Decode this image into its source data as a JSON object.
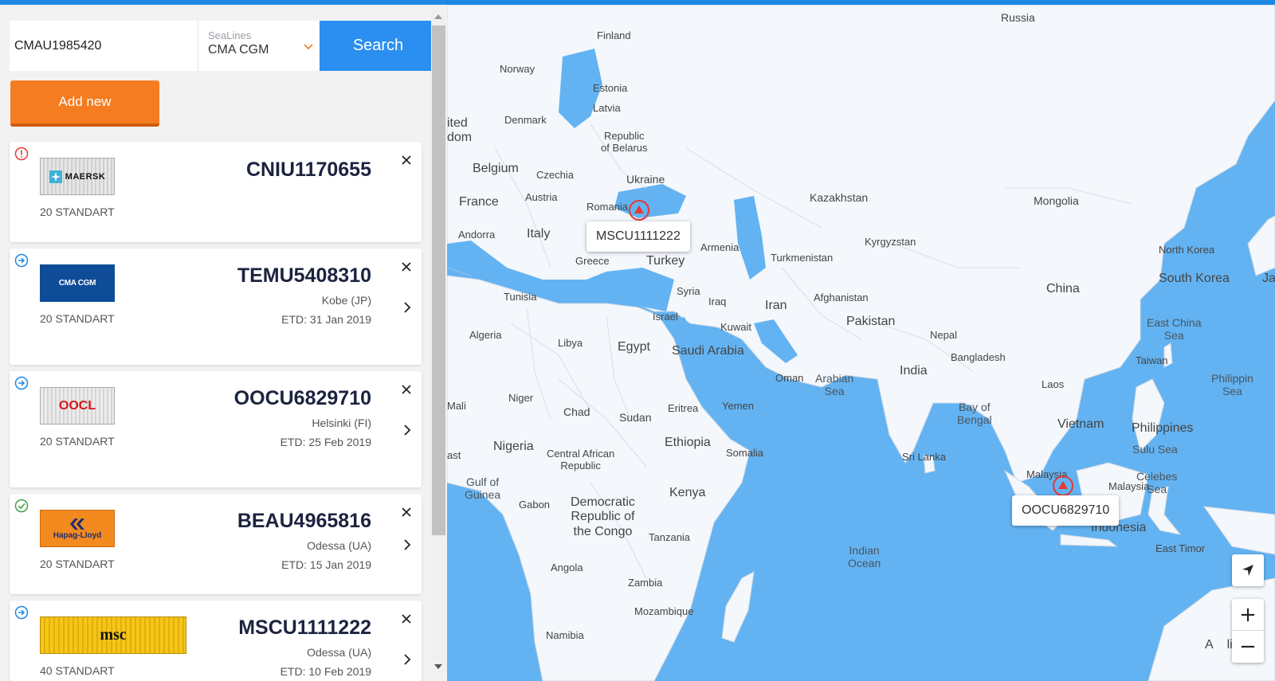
{
  "search": {
    "container_value": "CMAU1985420",
    "sealine_label": "SeaLines",
    "sealine_value": "CMA CGM",
    "button_label": "Search"
  },
  "add_new_label": "Add new",
  "containers": [
    {
      "status": "alert",
      "carrier": "MAERSK",
      "number": "CNIU1170655",
      "type": "20 STANDART",
      "port": "",
      "etd": ""
    },
    {
      "status": "in-transit",
      "carrier": "CMA CGM",
      "number": "TEMU5408310",
      "type": "20 STANDART",
      "port": "Kobe (JP)",
      "etd": "ETD: 31 Jan 2019"
    },
    {
      "status": "in-transit",
      "carrier": "OOCL",
      "number": "OOCU6829710",
      "type": "20 STANDART",
      "port": "Helsinki (FI)",
      "etd": "ETD: 25 Feb 2019"
    },
    {
      "status": "arrived",
      "carrier": "Hapag-Lloyd",
      "number": "BEAU4965816",
      "type": "20 STANDART",
      "port": "Odessa (UA)",
      "etd": "ETD: 15 Jan 2019"
    },
    {
      "status": "in-transit",
      "carrier": "msc",
      "number": "MSCU1111222",
      "type": "40 STANDART",
      "port": "Odessa (UA)",
      "etd": "ETD: 10 Feb 2019"
    }
  ],
  "map": {
    "popups": [
      "MSCU1111222",
      "OOCU6829710"
    ],
    "zoom_in": "+",
    "zoom_out": "−",
    "labels": {
      "russia": "Russia",
      "finland": "Finland",
      "norway": "Norway",
      "estonia": "Estonia",
      "latvia": "Latvia",
      "denmark": "Denmark",
      "united_kingdom": "ited\ndom",
      "belarus": "Republic\nof Belarus",
      "belgium": "Belgium",
      "czechia": "Czechia",
      "ukraine": "Ukraine",
      "austria": "Austria",
      "france": "France",
      "romania": "Romania",
      "andorra": "Andorra",
      "italy": "Italy",
      "greece": "Greece",
      "turkey": "Turkey",
      "armenia": "Armenia",
      "kazakhstan": "Kazakhstan",
      "mongolia": "Mongolia",
      "kyrgyzstan": "Kyrgyzstan",
      "turkmenistan": "Turkmenistan",
      "north_korea": "North Korea",
      "south_korea": "South Korea",
      "japan": "Ja",
      "china": "China",
      "tunisia": "Tunisia",
      "syria": "Syria",
      "iraq": "Iraq",
      "iran": "Iran",
      "afghanistan": "Afghanistan",
      "israel": "Israel",
      "kuwait": "Kuwait",
      "pakistan": "Pakistan",
      "algeria": "Algeria",
      "libya": "Libya",
      "egypt": "Egypt",
      "saudi_arabia": "Saudi Arabia",
      "nepal": "Nepal",
      "east_china_sea": "East China\nSea",
      "taiwan": "Taiwan",
      "oman": "Oman",
      "arabian_sea": "Arabian\nSea",
      "india": "India",
      "bangladesh": "Bangladesh",
      "philippine_sea": "Philippin\nSea",
      "laos": "Laos",
      "mali": "Mali",
      "niger": "Niger",
      "chad": "Chad",
      "eritrea": "Eritrea",
      "yemen": "Yemen",
      "sudan": "Sudan",
      "bay_of_bengal": "Bay of\nBengal",
      "vietnam": "Vietnam",
      "philippines": "Philippines",
      "nigeria": "Nigeria",
      "ethiopia": "Ethiopia",
      "somalia": "Somalia",
      "car": "Central African\nRepublic",
      "sri_lanka": "Sri Lanka",
      "sulu_sea": "Sulu Sea",
      "coast": "ast",
      "gulf_of_guinea": "Gulf of\nGuinea",
      "gabon": "Gabon",
      "drc": "Democratic\nRepublic of\nthe Congo",
      "kenya": "Kenya",
      "malaysia_w": "Malaysia",
      "malaysia_e": "Malaysia",
      "celebes_sea": "Celebes\nSea",
      "tanzania": "Tanzania",
      "indonesia": "Indonesia",
      "east_timor": "East Timor",
      "indian_ocean": "Indian\nOcean",
      "angola": "Angola",
      "zambia": "Zambia",
      "mozambique": "Mozambique",
      "namibia": "Namibia",
      "australia": "A    li"
    }
  }
}
